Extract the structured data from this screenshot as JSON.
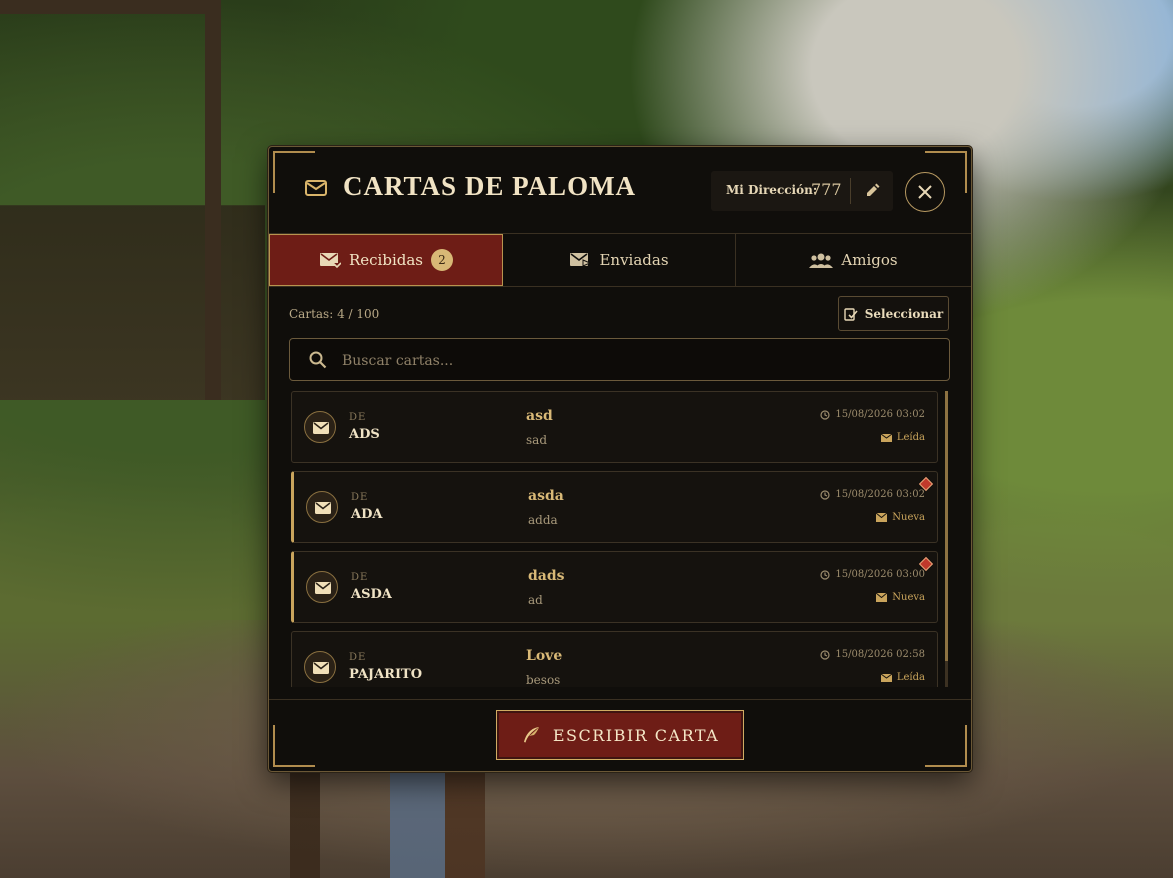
{
  "header": {
    "title": "CARTAS DE PALOMA",
    "address_label": "Mi Dirección:",
    "address_value": "777"
  },
  "tabs": [
    {
      "label": "Recibidas",
      "badge": "2",
      "active": true,
      "icon": "inbox-mail-icon"
    },
    {
      "label": "Enviadas",
      "active": false,
      "icon": "send-mail-icon"
    },
    {
      "label": "Amigos",
      "active": false,
      "icon": "friends-icon"
    }
  ],
  "toolbar": {
    "count_text": "Cartas: 4 / 100",
    "select_label": "Seleccionar"
  },
  "search": {
    "placeholder": "Buscar cartas...",
    "value": ""
  },
  "letters": [
    {
      "de": "DE",
      "from": "ADS",
      "subject": "asd",
      "preview": "sad",
      "time": "15/08/2026 03:02",
      "status": "Leída",
      "unread": false
    },
    {
      "de": "DE",
      "from": "ADA",
      "subject": "asda",
      "preview": "adda",
      "time": "15/08/2026 03:02",
      "status": "Nueva",
      "unread": true
    },
    {
      "de": "DE",
      "from": "ASDA",
      "subject": "dads",
      "preview": "ad",
      "time": "15/08/2026 03:00",
      "status": "Nueva",
      "unread": true
    },
    {
      "de": "DE",
      "from": "PAJARITO",
      "subject": "Love",
      "preview": "besos",
      "time": "15/08/2026 02:58",
      "status": "Leída",
      "unread": false
    }
  ],
  "footer": {
    "write_label": "ESCRIBIR CARTA"
  },
  "colors": {
    "accent_red": "#6e1d16",
    "gold": "#c9a45c",
    "panel_bg": "#100e0b",
    "unread_marker": "#c0392b"
  }
}
